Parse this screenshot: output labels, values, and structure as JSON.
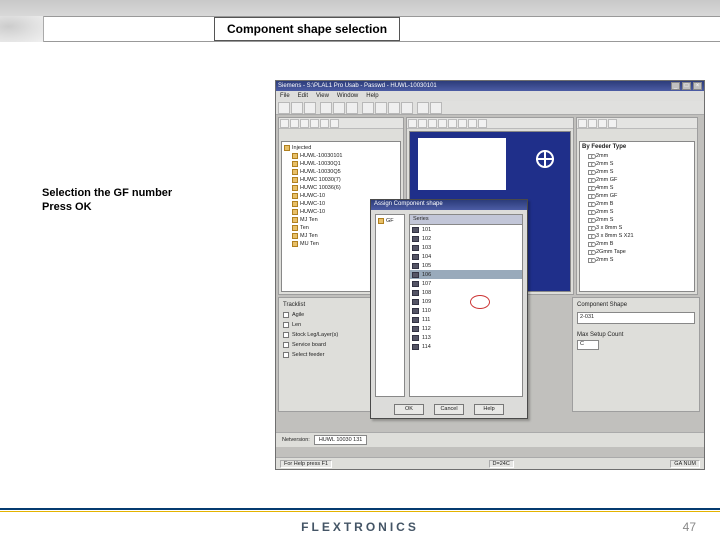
{
  "slide": {
    "header_title": "Component shape selection",
    "caption_line1": "Selection the GF number",
    "caption_line2": "Press OK",
    "footer_brand": "FLEXTRONICS",
    "page_number": "47"
  },
  "app": {
    "title": "Siemens - S:\\PLAL1 Pro Usab - Passwd - HUWL-10030101",
    "menus": [
      "File",
      "Edit",
      "View",
      "Window",
      "Help"
    ]
  },
  "left_tree_root": "Injected",
  "left_tree": [
    "HUWL-10030101",
    "HUWL-10030Q1",
    "HUWL-10030Q5",
    "HUWC 10030(7)",
    "HUWC 10036(6)",
    "HUWC-10",
    "HUWC-10",
    "HUWC-10",
    "MJ Ten",
    "Ten",
    "MJ Ten",
    "MU Ten"
  ],
  "feeder_title": "By Feeder Type",
  "feeder_tree": [
    "2mm",
    "2mm S",
    "2mm S",
    "2mm GF",
    "4mm S",
    "5mm GF",
    "2mm B",
    "2mm S",
    "2mm S",
    "3 x 8mm S",
    "3 x 8mm S X21",
    "2mm B",
    "2Gmm Tape",
    "2mm S"
  ],
  "tracklist": {
    "title": "Tracklist",
    "options": [
      "Agile",
      "Len",
      "Stock Leg/Layer(s)",
      "Service board",
      "Select feeder"
    ]
  },
  "cshape": {
    "title": "Component Shape",
    "value": "2-031",
    "setup_label": "Max Setup Count",
    "setup_value": "C"
  },
  "modal": {
    "title": "Assign Component shape",
    "header": "Series",
    "tree_root": "GF",
    "rows": [
      "101",
      "102",
      "103",
      "104",
      "105",
      "106",
      "107",
      "108",
      "109",
      "110",
      "111",
      "112",
      "113",
      "114"
    ],
    "selected_index": 5,
    "buttons": {
      "ok": "OK",
      "cancel": "Cancel",
      "help": "Help"
    }
  },
  "tabs": {
    "label": "Netversion:",
    "active": "HUWL 10030 131"
  },
  "status": {
    "left": "For Help press F1",
    "mid": "D=24C",
    "right": "GA    NUM"
  }
}
